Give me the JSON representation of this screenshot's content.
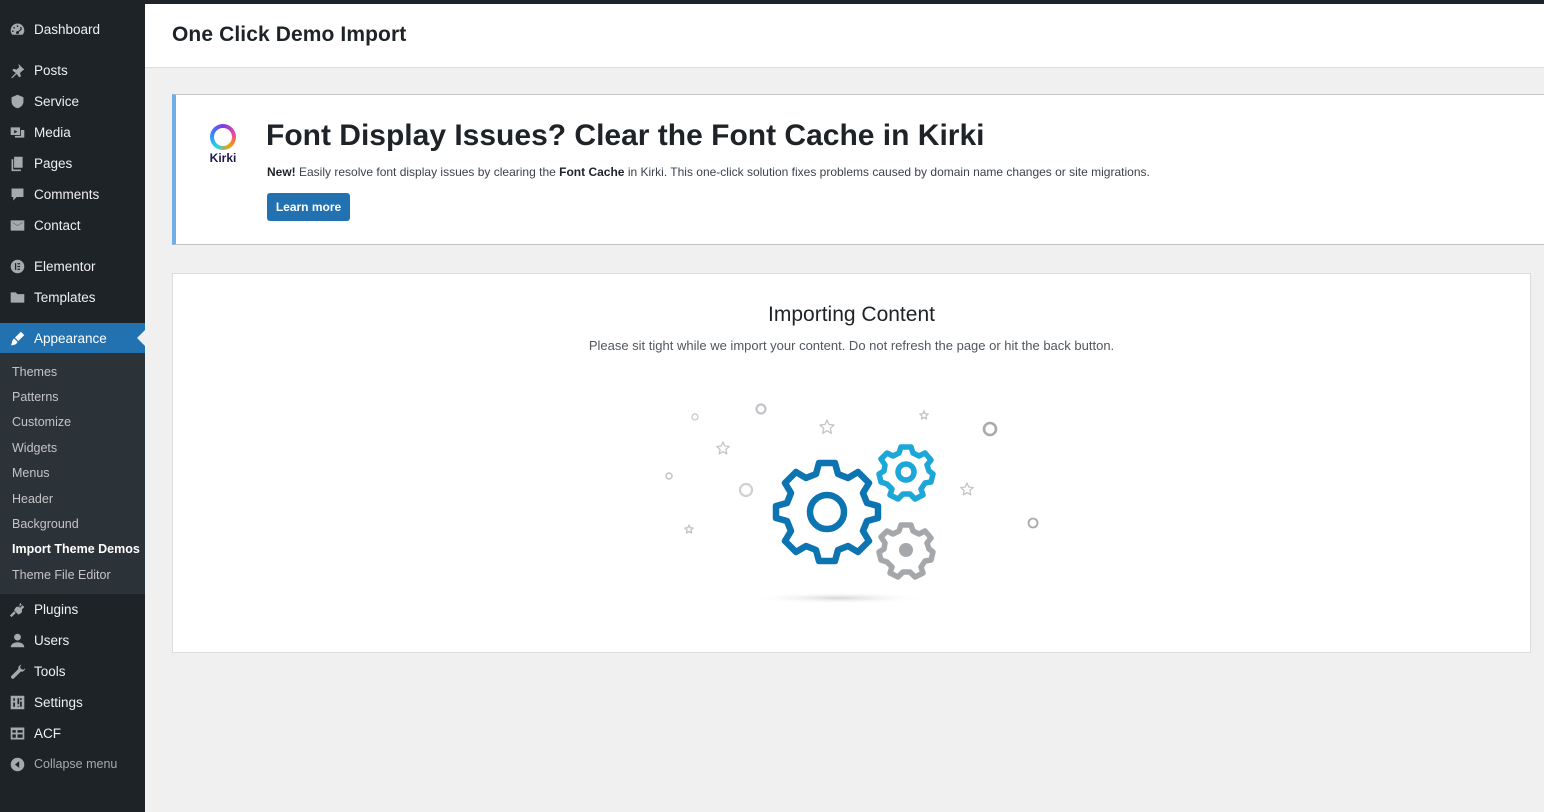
{
  "sidebar": {
    "items": [
      {
        "label": "Dashboard",
        "icon": "dashboard-icon"
      },
      {
        "label": "Posts",
        "icon": "pin-icon"
      },
      {
        "label": "Service",
        "icon": "shield-icon"
      },
      {
        "label": "Media",
        "icon": "media-icon"
      },
      {
        "label": "Pages",
        "icon": "pages-icon"
      },
      {
        "label": "Comments",
        "icon": "comment-icon"
      },
      {
        "label": "Contact",
        "icon": "mail-icon"
      },
      {
        "label": "Elementor",
        "icon": "elementor-icon"
      },
      {
        "label": "Templates",
        "icon": "folder-icon"
      },
      {
        "label": "Appearance",
        "icon": "brush-icon"
      },
      {
        "label": "Plugins",
        "icon": "plugin-icon"
      },
      {
        "label": "Users",
        "icon": "user-icon"
      },
      {
        "label": "Tools",
        "icon": "wrench-icon"
      },
      {
        "label": "Settings",
        "icon": "settings-icon"
      },
      {
        "label": "ACF",
        "icon": "table-icon"
      },
      {
        "label": "Collapse menu",
        "icon": "collapse-icon"
      }
    ],
    "appearance_sub": [
      "Themes",
      "Patterns",
      "Customize",
      "Widgets",
      "Menus",
      "Header",
      "Background",
      "Import Theme Demos",
      "Theme File Editor"
    ]
  },
  "header": {
    "title": "One Click Demo Import"
  },
  "notice": {
    "logo_text": "Kirki",
    "title": "Font Display Issues? Clear the Font Cache in Kirki",
    "text_new": "New!",
    "text_a": " Easily resolve font display issues by clearing the ",
    "text_bold": "Font Cache",
    "text_b": " in Kirki. This one-click solution fixes problems caused by domain name changes or site migrations.",
    "button": "Learn more"
  },
  "importing": {
    "title": "Importing Content",
    "subtitle": "Please sit tight while we import your content. Do not refresh the page or hit the back button."
  },
  "colors": {
    "accent": "#2271b1",
    "gear_blue": "#0c74b0",
    "gear_cyan": "#1ca7d8",
    "gear_gray": "#a5a8ab"
  }
}
